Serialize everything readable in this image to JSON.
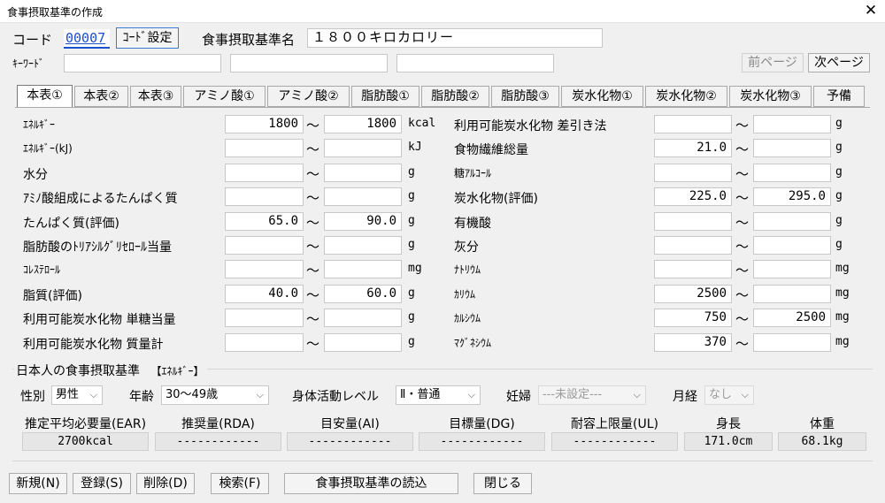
{
  "window": {
    "title": "食事摂取基準の作成",
    "close_glyph": "✕"
  },
  "header": {
    "code_label": "コード",
    "code_value": "00007",
    "code_setting_button": "ｺｰﾄﾞ設定",
    "name_label": "食事摂取基準名",
    "name_value": "１８００キロカロリー",
    "keyword_label": "ｷｰﾜｰﾄﾞ",
    "prev_page": "前ページ",
    "next_page": "次ページ"
  },
  "tabs": [
    "本表①",
    "本表②",
    "本表③",
    "アミノ酸①",
    "アミノ酸②",
    "脂肪酸①",
    "脂肪酸②",
    "脂肪酸③",
    "炭水化物①",
    "炭水化物②",
    "炭水化物③",
    "予備"
  ],
  "active_tab": "本表①",
  "tilde": "～",
  "left_rows": [
    {
      "label": "ｴﾈﾙｷﾞｰ",
      "min": "1800",
      "max": "1800",
      "unit": "kcal"
    },
    {
      "label": "ｴﾈﾙｷﾞｰ(kJ)",
      "min": "",
      "max": "",
      "unit": "kJ"
    },
    {
      "label": "水分",
      "min": "",
      "max": "",
      "unit": "g"
    },
    {
      "label": "ｱﾐﾉ酸組成によるたんぱく質",
      "min": "",
      "max": "",
      "unit": "g"
    },
    {
      "label": "たんぱく質(評価)",
      "min": "65.0",
      "max": "90.0",
      "unit": "g"
    },
    {
      "label": "脂肪酸のﾄﾘｱｼﾙｸﾞﾘｾﾛｰﾙ当量",
      "min": "",
      "max": "",
      "unit": "g"
    },
    {
      "label": "ｺﾚｽﾃﾛｰﾙ",
      "min": "",
      "max": "",
      "unit": "mg"
    },
    {
      "label": "脂質(評価)",
      "min": "40.0",
      "max": "60.0",
      "unit": "g"
    },
    {
      "label": "利用可能炭水化物 単糖当量",
      "min": "",
      "max": "",
      "unit": "g"
    },
    {
      "label": "利用可能炭水化物 質量計",
      "min": "",
      "max": "",
      "unit": "g"
    }
  ],
  "right_rows": [
    {
      "label": "利用可能炭水化物 差引き法",
      "min": "",
      "max": "",
      "unit": "g"
    },
    {
      "label": "食物繊維総量",
      "min": "21.0",
      "max": "",
      "unit": "g"
    },
    {
      "label": "糖ｱﾙｺｰﾙ",
      "min": "",
      "max": "",
      "unit": "g"
    },
    {
      "label": "炭水化物(評価)",
      "min": "225.0",
      "max": "295.0",
      "unit": "g"
    },
    {
      "label": "有機酸",
      "min": "",
      "max": "",
      "unit": "g"
    },
    {
      "label": "灰分",
      "min": "",
      "max": "",
      "unit": "g"
    },
    {
      "label": "ﾅﾄﾘｳﾑ",
      "min": "",
      "max": "",
      "unit": "mg"
    },
    {
      "label": "ｶﾘｳﾑ",
      "min": "2500",
      "max": "",
      "unit": "mg"
    },
    {
      "label": "ｶﾙｼｳﾑ",
      "min": "750",
      "max": "2500",
      "unit": "mg"
    },
    {
      "label": "ﾏｸﾞﾈｼｳﾑ",
      "min": "370",
      "max": "",
      "unit": "mg"
    }
  ],
  "dri": {
    "section_label": "日本人の食事摂取基準",
    "section_sub": "【ｴﾈﾙｷﾞｰ】",
    "sex_label": "性別",
    "sex_value": "男性",
    "age_label": "年齢",
    "age_value": "30～49歳",
    "activity_label": "身体活動レベル",
    "activity_value": "Ⅱ・普通",
    "pregnant_label": "妊婦",
    "pregnant_value": "---未設定---",
    "menses_label": "月経",
    "menses_value": "なし",
    "stats": [
      {
        "header": "推定平均必要量(EAR)",
        "value": "2700kcal"
      },
      {
        "header": "推奨量(RDA)",
        "value": "------------"
      },
      {
        "header": "目安量(AI)",
        "value": "------------"
      },
      {
        "header": "目標量(DG)",
        "value": "------------"
      },
      {
        "header": "耐容上限量(UL)",
        "value": "------------"
      },
      {
        "header": "身長",
        "value": "171.0cm"
      },
      {
        "header": "体重",
        "value": "68.1kg"
      }
    ]
  },
  "footer": {
    "new": "新規(N)",
    "register": "登録(S)",
    "delete": "削除(D)",
    "search": "検索(F)",
    "load": "食事摂取基準の読込",
    "close": "閉じる"
  }
}
